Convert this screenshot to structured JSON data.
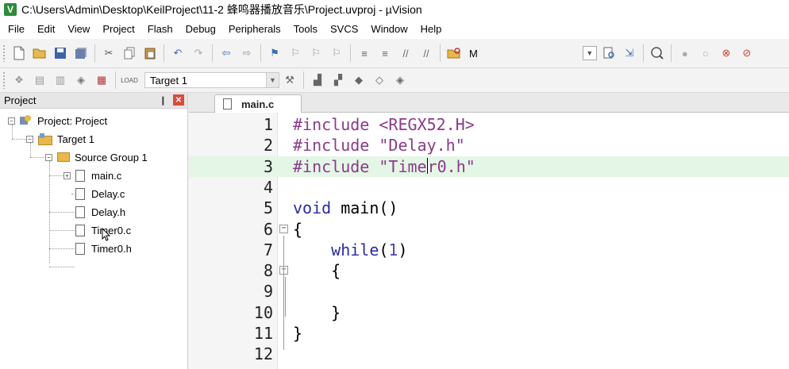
{
  "window": {
    "title": "C:\\Users\\Admin\\Desktop\\KeilProject\\11-2 蜂鸣器播放音乐\\Project.uvproj - µVision"
  },
  "menu": [
    "File",
    "Edit",
    "View",
    "Project",
    "Flash",
    "Debug",
    "Peripherals",
    "Tools",
    "SVCS",
    "Window",
    "Help"
  ],
  "toolbar": {
    "mode_label": "M",
    "target_select": "Target 1"
  },
  "project_panel": {
    "title": "Project",
    "pin": "❙",
    "close": "✕",
    "tree": {
      "root": "Project: Project",
      "target": "Target 1",
      "group": "Source Group 1",
      "files": [
        "main.c",
        "Delay.c",
        "Delay.h",
        "Timer0.c",
        "Timer0.h"
      ]
    }
  },
  "editor": {
    "tab": "main.c",
    "line_numbers": [
      "1",
      "2",
      "3",
      "4",
      "5",
      "6",
      "7",
      "8",
      "9",
      "10",
      "11",
      "12"
    ],
    "lines": {
      "l1_pre": "#include ",
      "l1_str": "<REGX52.H>",
      "l2_pre": "#include ",
      "l2_str": "\"Delay.h\"",
      "l3_pre": "#include ",
      "l3_str_a": "\"Time",
      "l3_str_b": "r0.h\"",
      "l5_kw": "void",
      "l5_rest": " main()",
      "l6": "{",
      "l7_kw": "    while",
      "l7_p1": "(",
      "l7_num": "1",
      "l7_p2": ")",
      "l8": "    {",
      "l10": "    }",
      "l11": "}"
    },
    "highlighted_line": 3
  },
  "colors": {
    "preprocessor": "#8b3a8b",
    "keyword": "#2a2aa6",
    "current_line": "#e4f6e6"
  }
}
